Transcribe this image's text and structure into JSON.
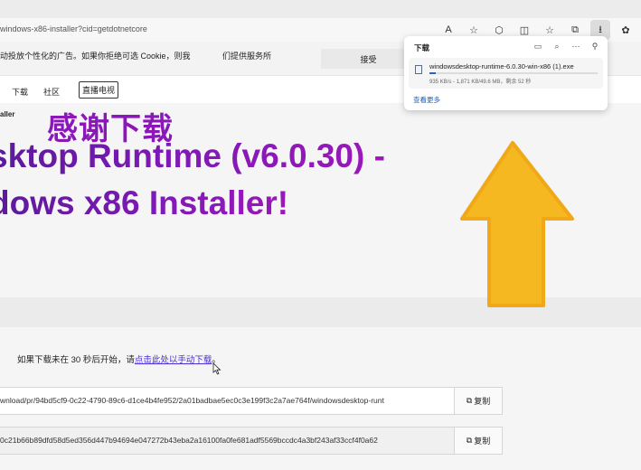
{
  "browser": {
    "address_url": "windows-x86-installer?cid=getdotnetcore",
    "toolbar_icons": [
      "read-aloud-icon",
      "favorite-star-icon",
      "extensions-icon",
      "split-screen-icon",
      "favorites-icon",
      "collections-icon",
      "downloads-icon",
      "copilot-icon"
    ],
    "read_aloud_glyph": "A",
    "star_glyph": "☆",
    "ext_glyph": "⬡",
    "split_glyph": "◫",
    "fav_glyph": "☆",
    "coll_glyph": "⧉",
    "download_glyph": "⭳",
    "copilot_glyph": "✿"
  },
  "cookie": {
    "text": "动投放个性化的广告。如果你拒绝可选 Cookie，则我",
    "text2": "们提供服务所",
    "accept_label": "接受"
  },
  "nav": {
    "download": "下载",
    "community": "社区",
    "live": "直播电视"
  },
  "breadcrumb": "aller",
  "hero": {
    "thanks": "感谢下载",
    "line1": "sktop Runtime (v6.0.30) -",
    "line2": "dows x86 Installer!"
  },
  "manual": {
    "prefix": "如果下载未在 30 秒后开始，请",
    "link": "点击此处以手动下载",
    "suffix": "。"
  },
  "direct_link": {
    "value": "wnload/pr/94bd5cf9-0c22-4790-89c6-d1ce4b4fe952/2a01badbae5ec0c3e199f3c2a7ae764f/windowsdesktop-runt",
    "copy_label": "复制"
  },
  "checksum": {
    "value": "0c21b66b89dfd58d5ed356d447b94694e047272b43eba2a16100fa0fe681adf5569bccdc4a3bf243af33ccf4f0a62",
    "copy_label": "复制"
  },
  "downloads_panel": {
    "title": "下载",
    "filename": "windowsdesktop-runtime-6.0.30-win-x86 (1).exe",
    "status": "935 KB/s - 1,871 KB/49.6 MB，剩余 52 秒",
    "progress": 0.04,
    "more": "查看更多",
    "action_glyphs": [
      "▭",
      "⌕",
      "⋯",
      "⚲"
    ]
  },
  "colors": {
    "hero_purple": "#8a18b8",
    "link_blue": "#4b2bd6",
    "arrow_yellow": "#f5b820",
    "progress_blue": "#2a62c9"
  }
}
